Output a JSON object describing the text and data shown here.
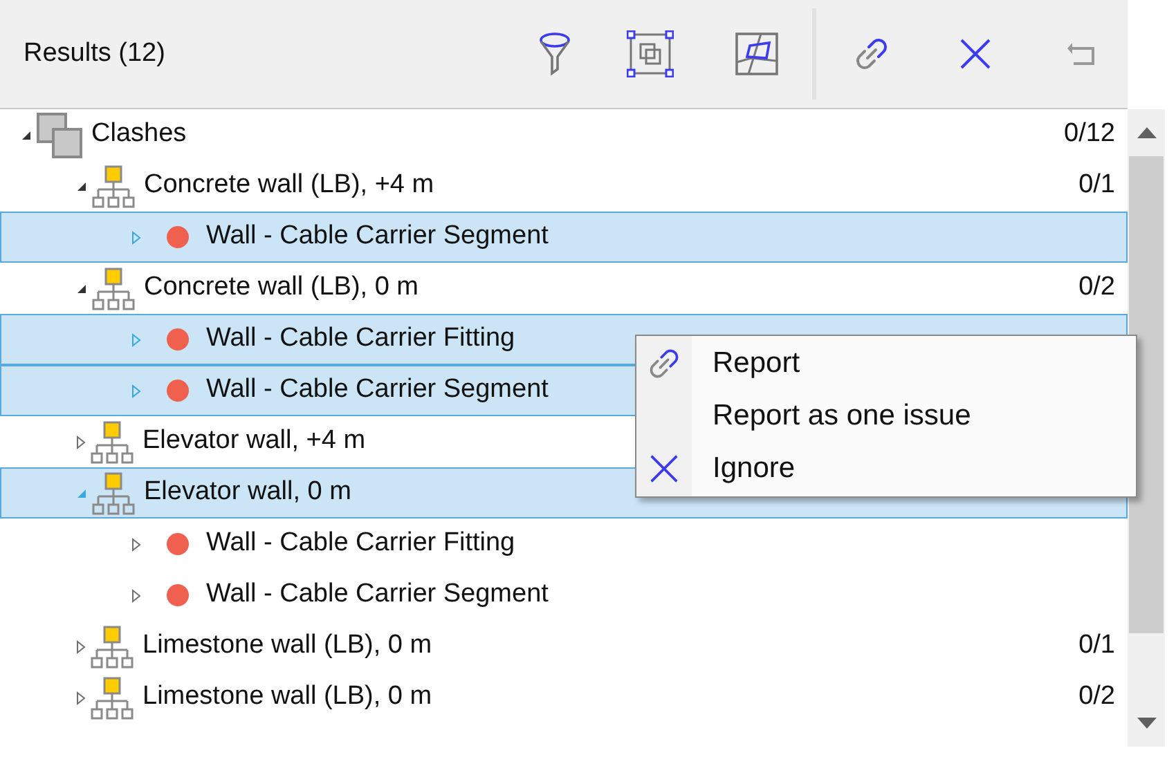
{
  "toolbar": {
    "title": "Results (12)"
  },
  "tree": [
    {
      "label": "Clashes",
      "kind": "group",
      "expanded": true,
      "selected": false,
      "count": "0/12",
      "children": [
        {
          "label": "Concrete wall (LB), +4 m",
          "kind": "category",
          "expanded": true,
          "selected": false,
          "count": "0/1",
          "children": [
            {
              "label": "Wall - Cable Carrier Segment",
              "kind": "clash",
              "expanded": false,
              "selected": true
            }
          ]
        },
        {
          "label": "Concrete wall (LB), 0 m",
          "kind": "category",
          "expanded": true,
          "selected": false,
          "count": "0/2",
          "children": [
            {
              "label": "Wall - Cable Carrier Fitting",
              "kind": "clash",
              "expanded": false,
              "selected": true
            },
            {
              "label": "Wall - Cable Carrier Segment",
              "kind": "clash",
              "expanded": false,
              "selected": true
            }
          ]
        },
        {
          "label": "Elevator wall, +4 m",
          "kind": "category",
          "expanded": false,
          "selected": false
        },
        {
          "label": "Elevator wall, 0 m",
          "kind": "category",
          "expanded": true,
          "selected": true,
          "children": [
            {
              "label": "Wall - Cable Carrier Fitting",
              "kind": "clash",
              "expanded": false,
              "selected": false
            },
            {
              "label": "Wall - Cable Carrier Segment",
              "kind": "clash",
              "expanded": false,
              "selected": false
            }
          ]
        },
        {
          "label": "Limestone wall (LB), 0 m",
          "kind": "category",
          "expanded": false,
          "selected": false,
          "count": "0/1"
        },
        {
          "label": "Limestone wall (LB), 0 m",
          "kind": "category",
          "expanded": false,
          "selected": false,
          "count": "0/2"
        }
      ]
    }
  ],
  "context_menu": [
    {
      "label": "Report",
      "kind": "link"
    },
    {
      "label": "Report as one issue",
      "kind": "plain"
    },
    {
      "label": "Ignore",
      "kind": "ignore"
    }
  ]
}
